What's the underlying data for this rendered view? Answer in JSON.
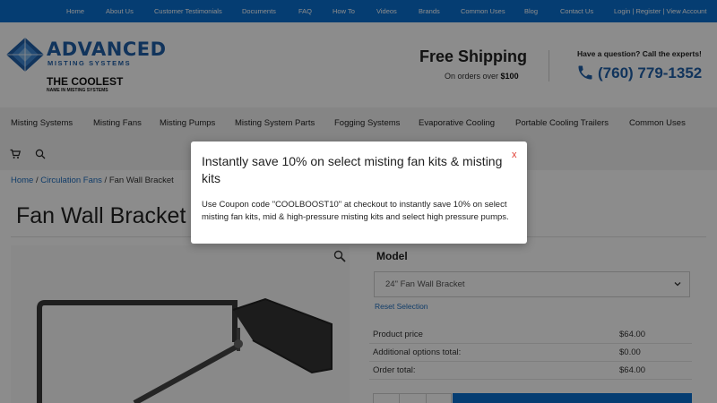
{
  "topbar": {
    "links": [
      "Home",
      "About Us",
      "Customer Testimonials",
      "Documents",
      "FAQ",
      "How To",
      "Videos",
      "Brands",
      "Common Uses",
      "Blog",
      "Contact Us"
    ],
    "account": "Login | Register | View Account"
  },
  "header": {
    "logo": {
      "word1": "ADVANCED",
      "word2": "MISTING SYSTEMS",
      "slogan1": "THE COOLEST",
      "slogan2": "NAME IN MISTING SYSTEMS"
    },
    "shipping": {
      "title": "Free Shipping",
      "sub_prefix": "On orders over",
      "sub_amount": "$100"
    },
    "contact": {
      "question": "Have a question? Call the experts!",
      "phone": "(760) 779-1352"
    }
  },
  "nav": {
    "items": [
      "Misting Systems",
      "Misting Fans",
      "Misting Pumps",
      "Misting System Parts",
      "Fogging Systems",
      "Evaporative Cooling",
      "Portable Cooling Trailers",
      "Common Uses"
    ],
    "icons": [
      "cart-icon",
      "search-icon"
    ]
  },
  "breadcrumb": {
    "home": "Home",
    "sep1": " / ",
    "category": "Circulation Fans",
    "sep2": " / ",
    "current": "Fan Wall Bracket"
  },
  "product": {
    "title": "Fan Wall Bracket",
    "model_label": "Model",
    "model_value": "24\" Fan Wall Bracket",
    "reset_label": "Reset Selection",
    "prices": [
      {
        "label": "Product price",
        "value": "$64.00"
      },
      {
        "label": "Additional options total:",
        "value": "$0.00"
      },
      {
        "label": "Order total:",
        "value": "$64.00"
      }
    ]
  },
  "modal": {
    "title": "Instantly save 10% on select misting fan kits & misting kits",
    "close_label": "x",
    "body": "Use Coupon code \"COOLBOOST10\" at checkout to instantly save 10% on select misting fan kits, mid & high-pressure misting kits and select high pressure pumps."
  },
  "colors": {
    "brand_blue": "#0a6fd0",
    "logo_blue": "#1f5fa8",
    "close_red": "#e03a2f"
  }
}
